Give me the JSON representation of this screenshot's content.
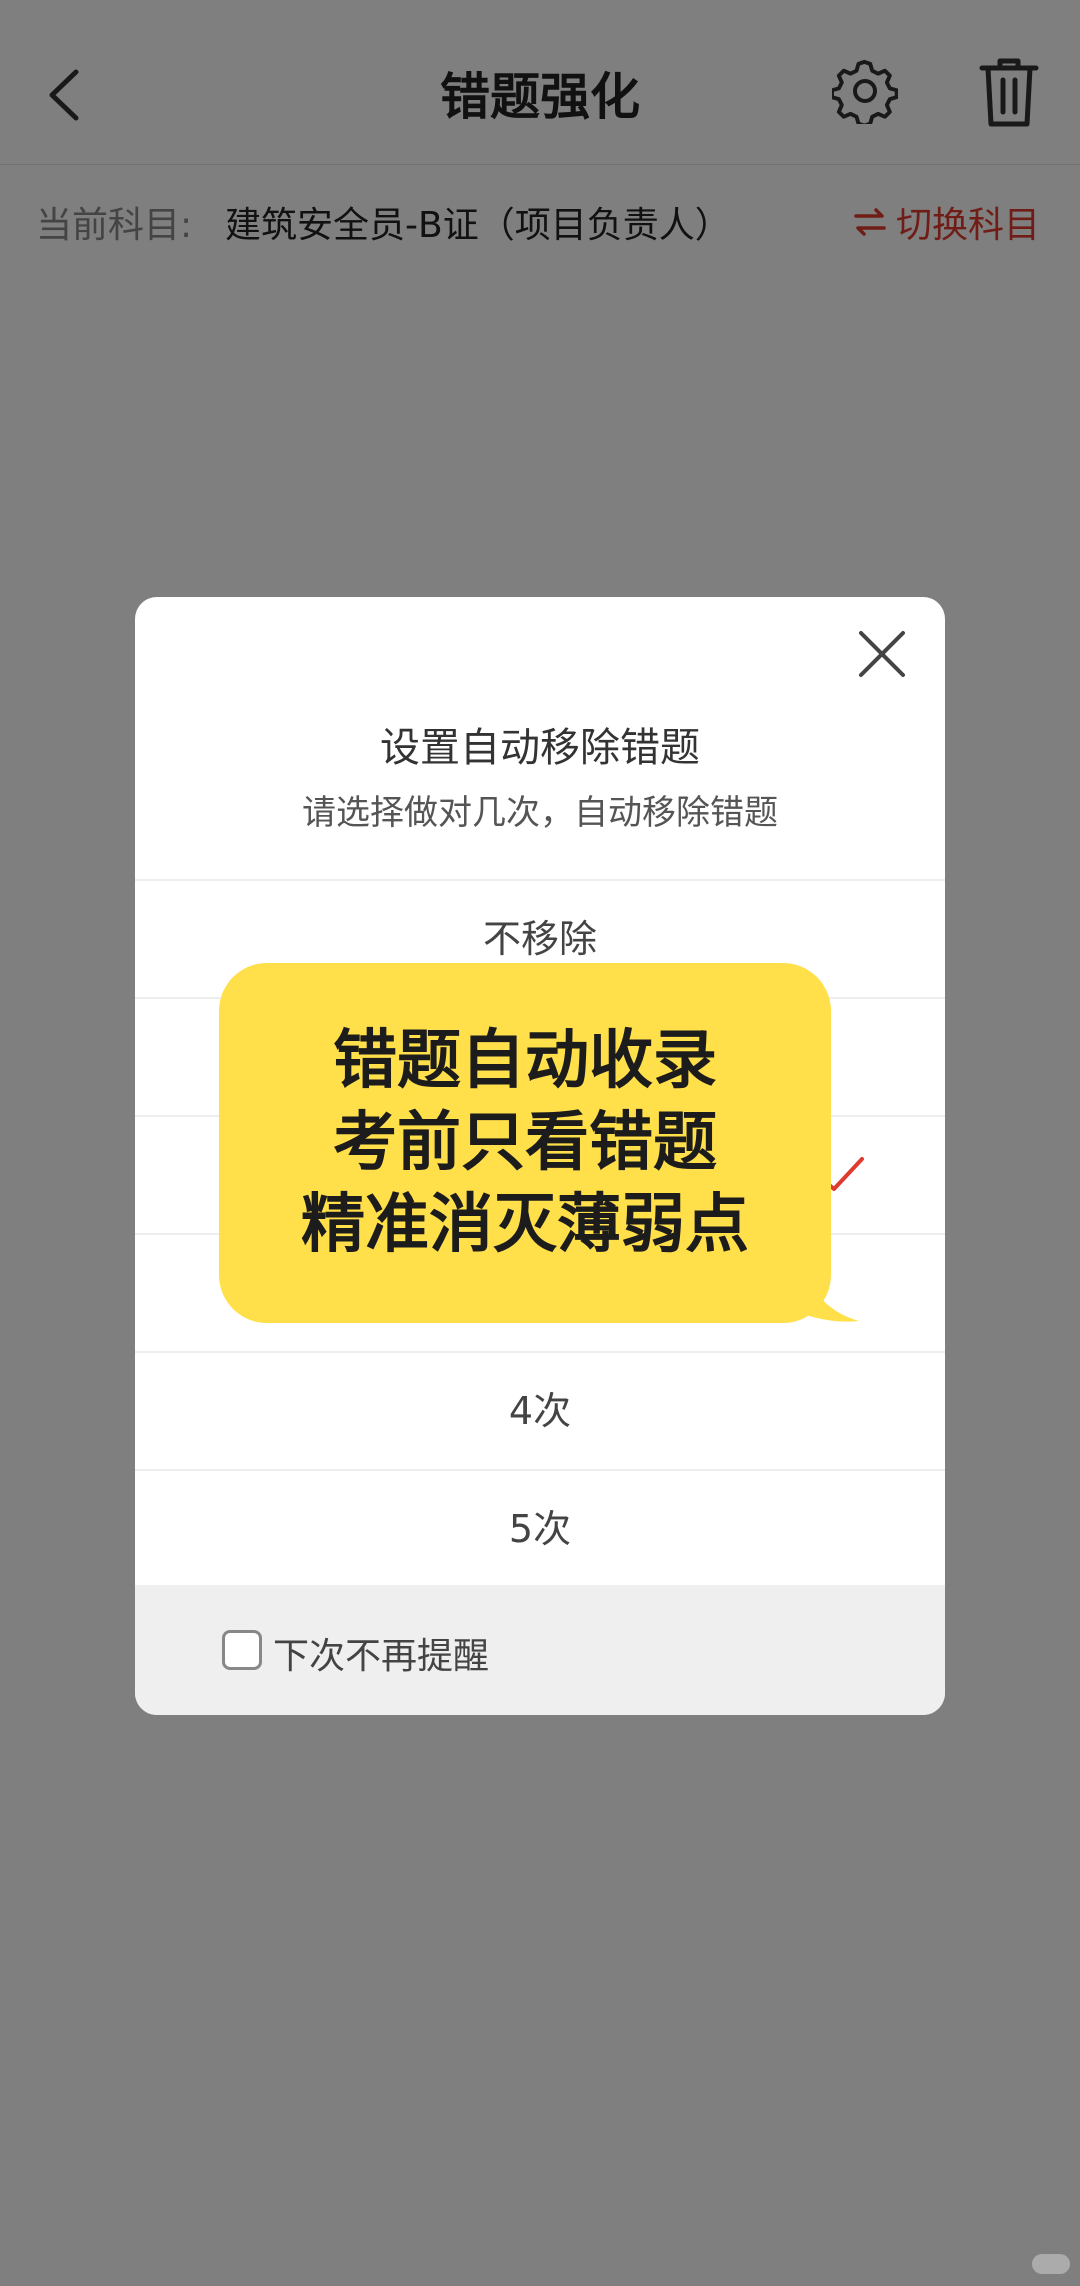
{
  "header": {
    "title": "错题强化",
    "back_icon": "chevron-left-icon",
    "settings_icon": "gear-icon",
    "trash_icon": "trash-icon"
  },
  "subject_bar": {
    "label": "当前科目:",
    "value": "建筑安全员-B证（项目负责人）",
    "switch_label": "切换科目",
    "switch_color": "#e03a2f"
  },
  "dialog": {
    "title": "设置自动移除错题",
    "subtitle": "请选择做对几次，自动移除错题",
    "options": [
      {
        "label": "不移除"
      },
      {
        "label": ""
      },
      {
        "label": ""
      },
      {
        "label": ""
      },
      {
        "label": "4次"
      },
      {
        "label": "5次"
      }
    ],
    "checkbox_label": "下次不再提醒"
  },
  "promo": {
    "lines": [
      "错题自动收录",
      "考前只看错题",
      "精准消灭薄弱点"
    ],
    "color": "#ffdf4a"
  }
}
